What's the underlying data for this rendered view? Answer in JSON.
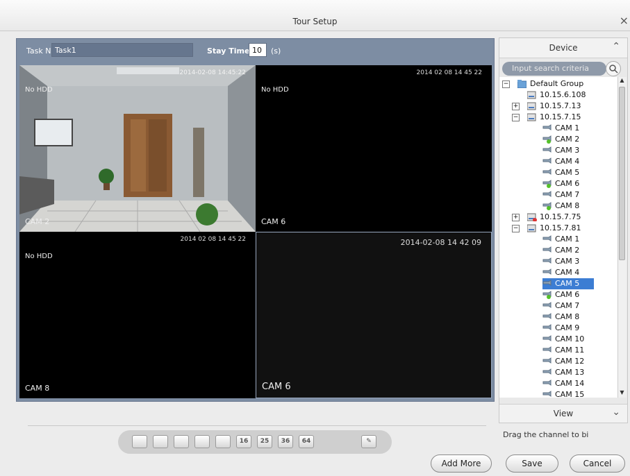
{
  "window": {
    "title": "Tour Setup",
    "close": "×"
  },
  "task": {
    "name_label": "Task N",
    "name_value": "Task1",
    "stay_label": "Stay Time",
    "stay_value": "10",
    "stay_unit": "(s)"
  },
  "cells": [
    {
      "timestamp": "2014-02-08 14:45:22",
      "no_hdd": "No HDD",
      "cam": "CAM 2"
    },
    {
      "timestamp": "2014 02 08 14 45 22",
      "no_hdd": "No HDD",
      "cam": "CAM 6"
    },
    {
      "timestamp": "2014 02 08 14 45 22",
      "no_hdd": "No HDD",
      "cam": "CAM 8"
    },
    {
      "timestamp": "2014-02-08 14 42 09",
      "no_hdd": "",
      "cam": "CAM 6"
    }
  ],
  "layouts": [
    "",
    "",
    "",
    "",
    "",
    "16",
    "25",
    "36",
    "64",
    ""
  ],
  "buttons": {
    "add_more": "Add More",
    "save": "Save",
    "cancel": "Cancel"
  },
  "device_panel": {
    "title": "Device",
    "search_placeholder": "Input search criteria",
    "view_title": "View",
    "drag_hint": "Drag the channel to bi"
  },
  "tree": [
    {
      "label": "Default Group",
      "expander": "−",
      "icon": "folder"
    },
    {
      "label": "10.15.6.108",
      "expander": "",
      "icon": "device"
    },
    {
      "label": "10.15.7.13",
      "expander": "+",
      "icon": "device"
    },
    {
      "label": "10.15.7.15",
      "expander": "−",
      "icon": "device"
    },
    {
      "label": "CAM 1",
      "icon": "cam"
    },
    {
      "label": "CAM 2",
      "icon": "cam-on"
    },
    {
      "label": "CAM 3",
      "icon": "cam"
    },
    {
      "label": "CAM 4",
      "icon": "cam"
    },
    {
      "label": "CAM 5",
      "icon": "cam"
    },
    {
      "label": "CAM 6",
      "icon": "cam-on"
    },
    {
      "label": "CAM 7",
      "icon": "cam"
    },
    {
      "label": "CAM 8",
      "icon": "cam-on"
    },
    {
      "label": "10.15.7.75",
      "expander": "+",
      "icon": "device-err"
    },
    {
      "label": "10.15.7.81",
      "expander": "−",
      "icon": "device"
    },
    {
      "label": "CAM 1",
      "icon": "cam"
    },
    {
      "label": "CAM 2",
      "icon": "cam"
    },
    {
      "label": "CAM 3",
      "icon": "cam"
    },
    {
      "label": "CAM 4",
      "icon": "cam"
    },
    {
      "label": "CAM 5",
      "icon": "cam",
      "selected": true
    },
    {
      "label": "CAM 6",
      "icon": "cam-on"
    },
    {
      "label": "CAM 7",
      "icon": "cam"
    },
    {
      "label": "CAM 8",
      "icon": "cam"
    },
    {
      "label": "CAM 9",
      "icon": "cam"
    },
    {
      "label": "CAM 10",
      "icon": "cam"
    },
    {
      "label": "CAM 11",
      "icon": "cam"
    },
    {
      "label": "CAM 12",
      "icon": "cam"
    },
    {
      "label": "CAM 13",
      "icon": "cam"
    },
    {
      "label": "CAM 14",
      "icon": "cam"
    },
    {
      "label": "CAM 15",
      "icon": "cam"
    }
  ]
}
